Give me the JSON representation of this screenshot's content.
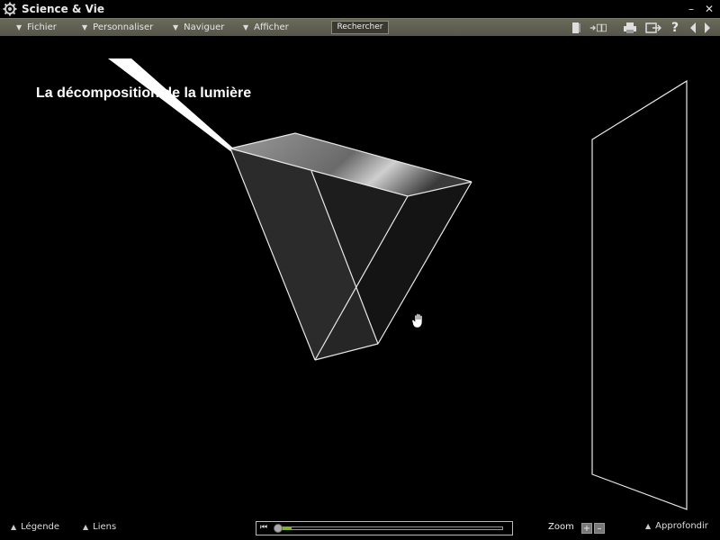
{
  "window": {
    "title": "Science & Vie",
    "minimize": "–",
    "close": "✕"
  },
  "menu": {
    "items": [
      {
        "label": "Fichier"
      },
      {
        "label": "Personnaliser"
      },
      {
        "label": "Naviguer"
      },
      {
        "label": "Afficher"
      }
    ],
    "search_label": "Rechercher"
  },
  "toolbar": {
    "icons": [
      "book-icon",
      "export-pages-icon",
      "print-icon",
      "share-icon",
      "help-icon",
      "previous-icon",
      "next-icon"
    ],
    "help_glyph": "?"
  },
  "scene": {
    "title": "La décomposition de la lumière"
  },
  "bottom": {
    "legend_label": "Légende",
    "links_label": "Liens",
    "zoom_label": "Zoom",
    "zoom_in": "+",
    "zoom_out": "–",
    "deepen_label": "Approfondir",
    "progress": 0.13,
    "accent_color": "#7db52d"
  }
}
